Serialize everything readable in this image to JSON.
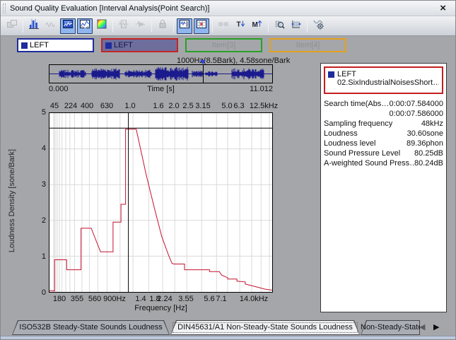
{
  "window": {
    "title": "Sound Quality Evaluation [Interval Analysis(Point Search)]",
    "close_label": "×"
  },
  "toolbar": {
    "items": [
      {
        "icon": "copy-window",
        "state": "disabled"
      },
      "|",
      {
        "icon": "bar-graph",
        "state": "normal"
      },
      {
        "icon": "waveform",
        "state": "disabled"
      },
      {
        "icon": "spectro-wave",
        "state": "pressed"
      },
      {
        "icon": "line-overlay",
        "state": "pressed"
      },
      {
        "icon": "colormap",
        "state": "normal"
      },
      "|",
      {
        "icon": "interval-select",
        "state": "disabled"
      },
      {
        "icon": "interval-wave",
        "state": "disabled"
      },
      "|",
      {
        "icon": "lock",
        "state": "disabled"
      },
      "|",
      {
        "icon": "wave-list",
        "state": "pressed"
      },
      {
        "icon": "point-search",
        "state": "pressed"
      },
      "|",
      {
        "icon": "link",
        "state": "disabled"
      },
      {
        "icon": "sort-time",
        "state": "normal"
      },
      {
        "icon": "sort-max",
        "state": "normal"
      },
      "|",
      {
        "icon": "zoom-grid",
        "state": "normal"
      },
      {
        "icon": "axis-scale",
        "state": "normal"
      },
      "|",
      {
        "icon": "analysis-settings",
        "state": "normal"
      }
    ]
  },
  "channel_tabs": [
    {
      "label": "LEFT",
      "border": "#1e2c9c",
      "bg": "#ffffff",
      "fg": "#000000",
      "swatch": "#1e2c9c",
      "dim": false
    },
    {
      "label": "LEFT",
      "border": "#c42424",
      "bg": "#6e6e9d",
      "fg": "#14144a",
      "swatch": "#1e2c9c",
      "dim": false
    },
    {
      "label": "Item[3]",
      "border": "#28a028",
      "bg": "#a5a6a9",
      "fg": "#8d9095",
      "swatch": "",
      "dim": true
    },
    {
      "label": "Item[4]",
      "border": "#e4a01c",
      "bg": "#a5a6a9",
      "fg": "#8d9095",
      "swatch": "",
      "dim": true
    }
  ],
  "overview": {
    "cursor_label": "1000Hz(8.5Bark), 4.58sone/Bark",
    "time_start": "0.000",
    "time_axis_label": "Time [s]",
    "time_end": "11.012",
    "cursor_frac": 0.6886,
    "waveform_color": "#1b1b8e",
    "bursts": [
      [
        0.045,
        0.165,
        0.55
      ],
      [
        0.19,
        0.315,
        0.8
      ],
      [
        0.34,
        0.46,
        0.55
      ],
      [
        0.475,
        0.625,
        0.95
      ],
      [
        0.64,
        0.69,
        0.45
      ],
      [
        0.7,
        0.755,
        0.4
      ],
      [
        0.82,
        0.965,
        0.75
      ]
    ]
  },
  "chart_data": {
    "type": "line",
    "title": "",
    "xlabel": "Frequency [Hz]",
    "ylabel": "Loudness Density [sone/Bark]",
    "x_axis_unit": "Bark (0-24), labeled in Hz",
    "xlim_bark": [
      0,
      24
    ],
    "ylim": [
      0,
      5
    ],
    "y_ticks": [
      "5",
      "4",
      "3",
      "2",
      "1",
      "0"
    ],
    "top_ticks": [
      {
        "label": "45",
        "frac": 0.024
      },
      {
        "label": "224",
        "frac": 0.099
      },
      {
        "label": "400",
        "frac": 0.169
      },
      {
        "label": "630",
        "frac": 0.26
      },
      {
        "label": "1.0",
        "frac": 0.362
      },
      {
        "label": "1.6",
        "frac": 0.49
      },
      {
        "label": "2.0",
        "frac": 0.558
      },
      {
        "label": "2.5",
        "frac": 0.623
      },
      {
        "label": "3.15",
        "frac": 0.687
      },
      {
        "label": "5.0",
        "frac": 0.794
      },
      {
        "label": "6.3",
        "frac": 0.848
      },
      {
        "label": "12.5kHz",
        "frac": 0.96
      }
    ],
    "bottom_ticks": [
      {
        "label": "180",
        "frac": 0.047
      },
      {
        "label": "355",
        "frac": 0.126
      },
      {
        "label": "560",
        "frac": 0.205
      },
      {
        "label": "900Hz",
        "frac": 0.293
      },
      {
        "label": "1.4",
        "frac": 0.41
      },
      {
        "label": "1.8",
        "frac": 0.473
      },
      {
        "label": "2.24",
        "frac": 0.517
      },
      {
        "label": "3.55",
        "frac": 0.612
      },
      {
        "label": "5.6",
        "frac": 0.716
      },
      {
        "label": "7.1",
        "frac": 0.77
      },
      {
        "label": "14.0kHz",
        "frac": 0.915
      }
    ],
    "grid_barks": [
      0.45,
      0.55,
      0.7,
      0.9,
      1.1,
      1.35,
      1.75,
      2.2,
      2.7,
      3.5,
      4.3,
      5.2,
      6.2,
      7.6,
      9.0,
      10.7,
      12.2,
      13.5,
      14.8,
      16.4,
      18.0,
      19.2,
      20.5,
      21.8,
      22.8,
      23.7
    ],
    "grid_y_values": [
      1,
      2,
      3,
      4
    ],
    "cursor": {
      "bark": 8.5,
      "value": 4.58
    },
    "curve_color": "#c41230",
    "curve_bark_sone": [
      [
        0,
        0.03
      ],
      [
        0.55,
        0.03
      ],
      [
        0.55,
        0.9
      ],
      [
        1.85,
        0.9
      ],
      [
        1.85,
        0.62
      ],
      [
        3.4,
        0.62
      ],
      [
        3.4,
        1.78
      ],
      [
        4.5,
        1.78
      ],
      [
        4.65,
        1.68
      ],
      [
        5.5,
        1.12
      ],
      [
        6.85,
        1.12
      ],
      [
        6.85,
        1.95
      ],
      [
        7.7,
        1.95
      ],
      [
        7.7,
        2.45
      ],
      [
        8.2,
        2.45
      ],
      [
        8.2,
        4.55
      ],
      [
        9.35,
        4.55
      ],
      [
        10.4,
        3.3
      ],
      [
        11.3,
        2.35
      ],
      [
        12.1,
        1.55
      ],
      [
        12.8,
        1.05
      ],
      [
        13.2,
        0.8
      ],
      [
        13.4,
        0.78
      ],
      [
        14.55,
        0.78
      ],
      [
        14.55,
        0.62
      ],
      [
        17.25,
        0.62
      ],
      [
        17.25,
        0.57
      ],
      [
        18.3,
        0.57
      ],
      [
        18.55,
        0.47
      ],
      [
        19.2,
        0.4
      ],
      [
        19.2,
        0.36
      ],
      [
        20.2,
        0.36
      ],
      [
        20.2,
        0.3
      ],
      [
        21.1,
        0.28
      ],
      [
        21.1,
        0.22
      ],
      [
        22.0,
        0.16
      ],
      [
        22.6,
        0.12
      ],
      [
        23.2,
        0.08
      ],
      [
        24,
        0.05
      ]
    ]
  },
  "info_panel": {
    "legend_name": "LEFT",
    "legend_file": "02.SixIndustrialNoisesShort…",
    "rows": [
      {
        "label": "Search time(Abs…",
        "value": "0:00:07.584000"
      },
      {
        "label": "",
        "value": "0:00:07.586000"
      },
      {
        "label": "Sampling frequency",
        "value": "48kHz"
      },
      {
        "label": "Loudness",
        "value": "30.60sone"
      },
      {
        "label": "Loudness level",
        "value": "89.36phon"
      },
      {
        "label": "Sound Pressure Level",
        "value": "80.25dB"
      },
      {
        "label": "A-weighted Sound Press…",
        "value": "80.24dB"
      }
    ]
  },
  "bottom_tabs": {
    "tabs": [
      {
        "label": "ISO532B Steady-State Sounds Loudness",
        "active": false,
        "clipped": false
      },
      {
        "label": "DIN45631/A1 Non-Steady-State Sounds Loudness",
        "active": true,
        "clipped": false
      },
      {
        "label": "Non-Steady-State",
        "active": false,
        "clipped": true
      }
    ],
    "scroll_left": "◀",
    "scroll_right": "▶"
  }
}
